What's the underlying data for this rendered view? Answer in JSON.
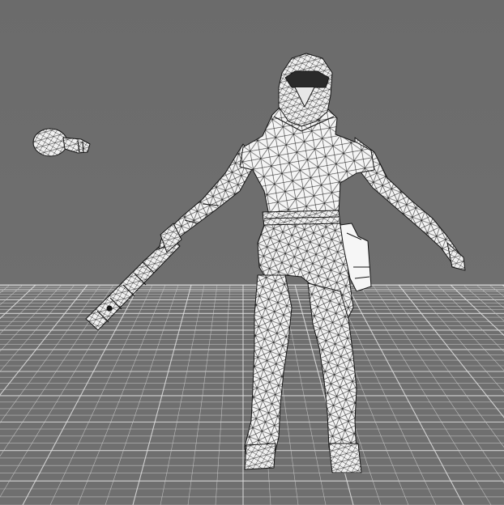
{
  "viewport": {
    "background": "#6c6c6c",
    "grid_color": "#c9c9c9",
    "grid_major_color": "#e2e2e2",
    "mesh_fill": "#f4f4f4",
    "mesh_wire": "#1a1a1a",
    "mesh_shade": "#b9b9b9"
  },
  "scene": {
    "subject": "wireframe-character-mesh",
    "render_mode": "wireframe-over-shaded",
    "ground_grid": "perspective-floor-grid",
    "detached_part": "small-mesh-object"
  }
}
